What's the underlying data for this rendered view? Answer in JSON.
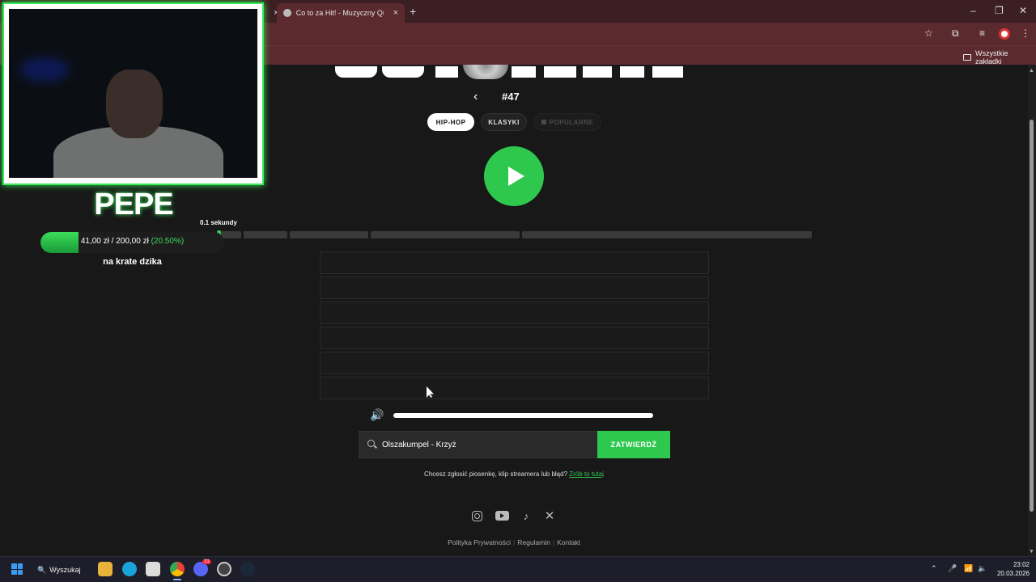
{
  "browser": {
    "tabs": [
      {
        "title": "",
        "active": false
      },
      {
        "title": "Co to za Hit! - Muzyczny Quiz i",
        "active": true
      }
    ],
    "new_tab_symbol": "+",
    "close_symbol": "×",
    "window_controls": {
      "minimize": "–",
      "maximize": "❐",
      "close": "✕"
    },
    "bookmarks_all": "Wszystkie zakładki"
  },
  "game": {
    "round_number": "#47",
    "back_symbol": "‹",
    "categories": [
      {
        "label": "HIP-HOP",
        "selected": true,
        "locked": false
      },
      {
        "label": "KLASYKI",
        "selected": false,
        "locked": false
      },
      {
        "label": "POPULARNE",
        "selected": false,
        "locked": true
      }
    ],
    "timer_label": "0.1 sekundy",
    "timer_progress_fraction": 0.004,
    "guess_rows_count": 6,
    "volume_level": 1.0,
    "search": {
      "value": "Olszakumpel - Krzyż",
      "placeholder": ""
    },
    "submit_label": "ZATWIERDŹ",
    "report_text": "Chcesz zgłosić piosenkę, klip streamera lub błąd?",
    "report_link": "Zrób to tutaj",
    "social_icons": [
      "instagram-icon",
      "youtube-icon",
      "tiktok-icon",
      "x-icon"
    ],
    "footer_links": [
      "Polityka Prywatności",
      "Regulamin",
      "Kontakt"
    ],
    "accent_color": "#2fc84f"
  },
  "overlay": {
    "streamer_name": "PEPE",
    "donation_current": "41,00 zł",
    "donation_separator": "/",
    "donation_goal": "200,00 zł",
    "donation_percent": "(20.50%)",
    "donation_fraction": 0.205,
    "goal_title": "na krate dzika",
    "frame_color": "#37e857"
  },
  "taskbar": {
    "search_label": "Wyszukaj",
    "discord_badge": "21",
    "time": "23:02",
    "date": "20.03.2026"
  }
}
